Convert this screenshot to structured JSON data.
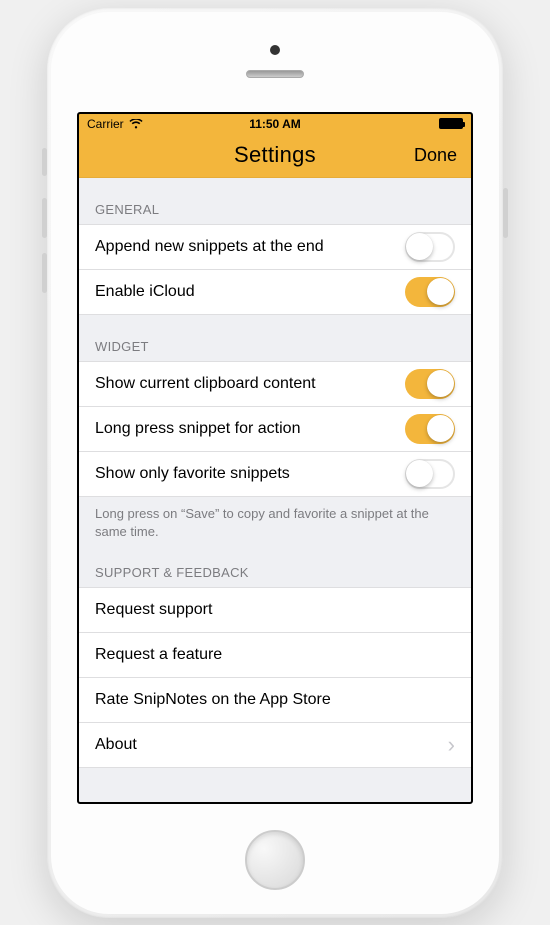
{
  "statusBar": {
    "carrier": "Carrier",
    "time": "11:50 AM"
  },
  "navBar": {
    "title": "Settings",
    "done": "Done"
  },
  "sections": {
    "general": {
      "header": "GENERAL",
      "rows": [
        {
          "label": "Append new snippets at the end",
          "toggle": false
        },
        {
          "label": "Enable iCloud",
          "toggle": true
        }
      ]
    },
    "widget": {
      "header": "WIDGET",
      "rows": [
        {
          "label": "Show current clipboard content",
          "toggle": true
        },
        {
          "label": "Long press snippet for action",
          "toggle": true
        },
        {
          "label": "Show only favorite snippets",
          "toggle": false
        }
      ],
      "footer": "Long press on “Save” to copy and favorite a snippet at the same time."
    },
    "support": {
      "header": "SUPPORT & FEEDBACK",
      "rows": [
        {
          "label": "Request support"
        },
        {
          "label": "Request a feature"
        },
        {
          "label": "Rate SnipNotes on the App Store"
        },
        {
          "label": "About",
          "disclosure": true
        }
      ]
    }
  }
}
